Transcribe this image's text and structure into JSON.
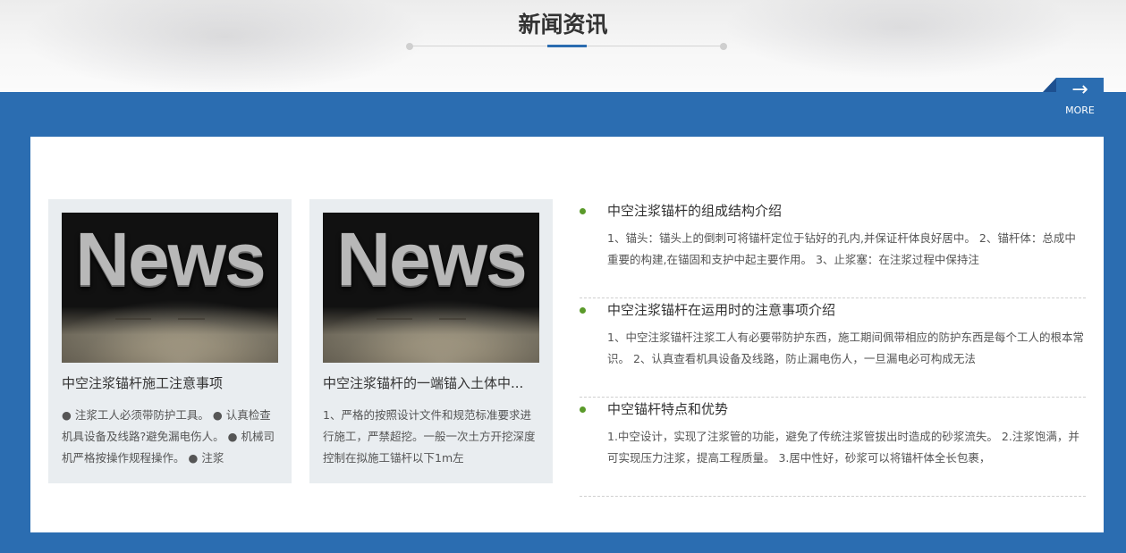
{
  "section": {
    "title": "新闻资讯",
    "more_label": "MORE",
    "more_icon": "→"
  },
  "colors": {
    "band": "#2b6db1",
    "bullet": "#5a9a2a",
    "card_bg": "#e9edf0"
  },
  "cards": [
    {
      "image_word": "News",
      "title": "中空注浆锚杆施工注意事项",
      "desc": "● 注浆工人必须带防护工具。 ● 认真检查机具设备及线路?避免漏电伤人。 ● 机械司机严格按操作规程操作。 ● 注浆"
    },
    {
      "image_word": "News",
      "title": "中空注浆锚杆的一端锚入土体中...",
      "desc": "1、严格的按照设计文件和规范标准要求进行施工，严禁超挖。一般一次土方开挖深度控制在拟施工锚杆以下1m左"
    }
  ],
  "list": [
    {
      "title": "中空注浆锚杆的组成结构介绍",
      "desc": "1、锚头：锚头上的倒刺可将锚杆定位于钻好的孔内,并保证杆体良好居中。 2、锚杆体：总成中重要的构建,在锚固和支护中起主要作用。 3、止浆塞：在注浆过程中保持注"
    },
    {
      "title": "中空注浆锚杆在运用时的注意事项介绍",
      "desc": "1、中空注浆锚杆注浆工人有必要带防护东西，施工期间佩带相应的防护东西是每个工人的根本常识。 2、认真查看机具设备及线路，防止漏电伤人，一旦漏电必可构成无法"
    },
    {
      "title": "中空锚杆特点和优势",
      "desc": "1.中空设计，实现了注浆管的功能，避免了传统注浆管拔出时造成的砂浆流失。 2.注浆饱满，并可实现压力注浆，提高工程质量。 3.居中性好，砂浆可以将锚杆体全长包裹，"
    }
  ]
}
